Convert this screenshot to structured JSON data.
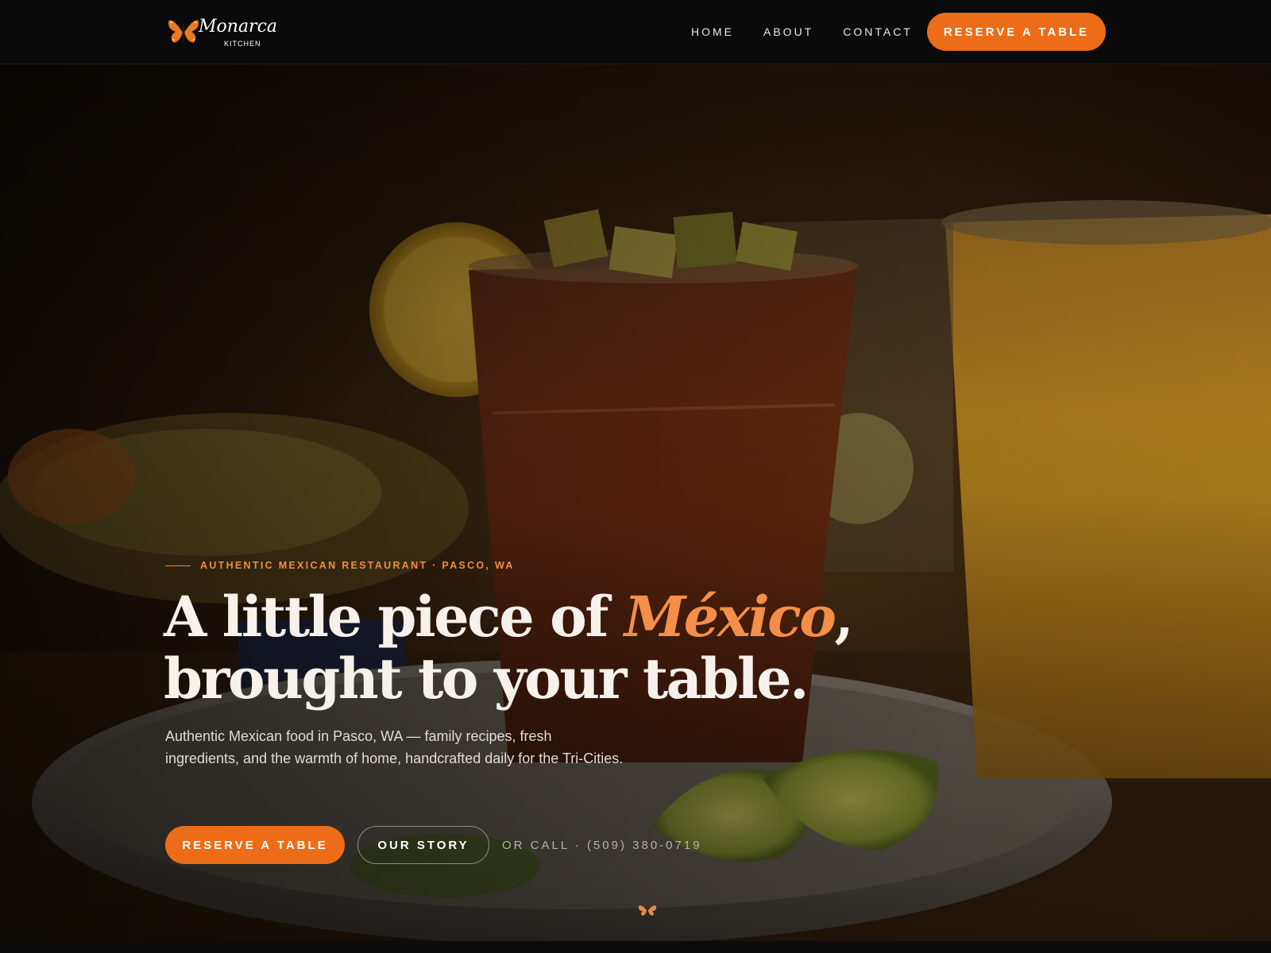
{
  "brand": {
    "name": "Monarca",
    "subtitle": "KITCHEN"
  },
  "nav": {
    "items": [
      "HOME",
      "ABOUT",
      "CONTACT"
    ],
    "cta_label": "RESERVE A TABLE"
  },
  "hero": {
    "eyebrow": "AUTHENTIC MEXICAN RESTAURANT · PASCO, WA",
    "headline_part1": "A little piece of ",
    "headline_accent": "México",
    "headline_part2": ",",
    "headline_line2": "brought to your table.",
    "description": "Authentic Mexican food in Pasco, WA — family recipes, fresh ingredients, and the warmth of home, handcrafted daily for the Tri-Cities.",
    "primary_label": "RESERVE A TABLE",
    "secondary_label": "OUR STORY",
    "call_text": "OR CALL · (509) 380-0719"
  },
  "colors": {
    "accent": "#ec6c17",
    "accent_text": "#f38f49",
    "header_bg": "#0a0a0a"
  },
  "icons": {
    "logo": "monarch-butterfly-icon",
    "scroll": "butterfly-scroll-icon"
  }
}
